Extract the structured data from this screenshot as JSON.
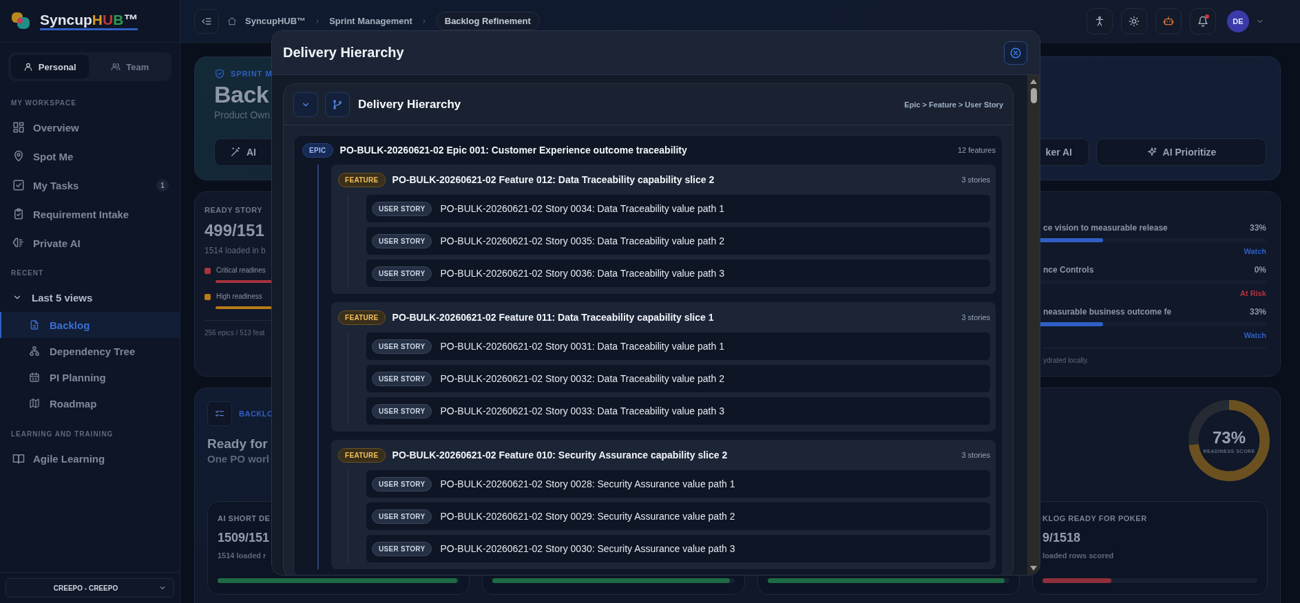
{
  "sidebar": {
    "brand": [
      {
        "text": "Syncup",
        "color": "#e2e6ee"
      },
      {
        "text": "H",
        "color": "#d99a1c"
      },
      {
        "text": "U",
        "color": "#c23a3a"
      },
      {
        "text": "B",
        "color": "#2f9a52"
      },
      {
        "text": "™",
        "color": "#e2e6ee"
      }
    ],
    "modes": [
      {
        "label": "Personal",
        "selected": true
      },
      {
        "label": "Team",
        "selected": false
      }
    ],
    "workspace": {
      "heading": "MY WORKSPACE",
      "items": [
        {
          "label": "Overview",
          "selected": false
        },
        {
          "label": "Spot Me",
          "selected": false
        },
        {
          "label": "My Tasks",
          "selected": false,
          "badge": "1"
        },
        {
          "label": "Requirement Intake",
          "selected": false
        },
        {
          "label": "Private AI",
          "selected": false
        }
      ]
    },
    "recent": {
      "heading": "RECENT",
      "group": {
        "label": "Last 5 views",
        "expanded": true,
        "children": [
          {
            "label": "Backlog",
            "selected": true
          },
          {
            "label": "Dependency Tree",
            "selected": false
          },
          {
            "label": "PI Planning",
            "selected": false
          },
          {
            "label": "Roadmap",
            "selected": false
          }
        ]
      }
    },
    "learning": {
      "heading": "LEARNING AND TRAINING",
      "items": [
        {
          "label": "Agile Learning",
          "selected": false
        }
      ]
    },
    "workspace_select": {
      "value": "CREEPO - CREEPO"
    }
  },
  "topbar": {
    "breadcrumbs": [
      {
        "label": "SyncupHUB™",
        "current": false
      },
      {
        "label": "Sprint Management",
        "current": false
      },
      {
        "label": "Backlog Refinement",
        "current": true
      }
    ],
    "notifications_unread": true,
    "avatar": "DE"
  },
  "dashboard": {
    "hero": {
      "eyebrow": "SPRINT M",
      "title": "Back",
      "subtitle": "Product Own",
      "buttons": [
        "AI",
        "ker AI",
        "AI Prioritize"
      ]
    },
    "ready_story": {
      "label": "READY STORY",
      "value": "499/151",
      "caption": "1514 loaded in b",
      "legend": [
        {
          "label": "Critical readines",
          "color": "#a8343f",
          "level": 0.5
        },
        {
          "label": "High readiness",
          "color": "#b97a17",
          "level": 0.6
        }
      ],
      "footer": "256 epics / 513 feat"
    },
    "risks": {
      "rows": [
        {
          "title": "ce vision to measurable release",
          "percent": "33%",
          "level": 0.33,
          "status": "Watch",
          "color": "#2f5fc4"
        },
        {
          "title": "nce Controls",
          "percent": "0%",
          "level": 0,
          "status": "At Risk",
          "color": "#b8323f"
        },
        {
          "title": "neasurable business outcome fe",
          "percent": "33%",
          "level": 0.33,
          "status": "Watch",
          "color": "#2f5fc4"
        }
      ],
      "footer": "ydrated locally."
    },
    "backlog": {
      "eyebrow": "BACKLO",
      "title": "Ready for",
      "subtitle": "One PO worl",
      "score": {
        "value": "73%",
        "label": "READINESS SCORE",
        "level": 0.73
      },
      "metrics": [
        {
          "label": "AI SHORT DE",
          "value": "1509/151",
          "caption": "1514 loaded r",
          "level": 0.99,
          "color": "#1d6b45"
        },
        {
          "level": 0.98,
          "color": "#1d6b45"
        },
        {
          "level": 0.98,
          "color": "#1d6b45"
        },
        {
          "label": "KLOG READY FOR POKER",
          "value": "9/1518",
          "caption": "loaded rows scored",
          "level": 0.32,
          "color": "#8f2f3a"
        }
      ]
    }
  },
  "modal": {
    "title": "Delivery Hierarchy",
    "panel": {
      "title": "Delivery Hierarchy",
      "path": "Epic > Feature > User Story",
      "expanded": true,
      "epic": {
        "badge": "EPIC",
        "title": "PO-BULK-20260621-02 Epic 001: Customer Experience outcome traceability",
        "count": "12 features",
        "children": [
          {
            "badge": "FEATURE",
            "title": "PO-BULK-20260621-02 Feature 012: Data Traceability capability slice 2",
            "count": "3 stories",
            "children": [
              {
                "badge": "USER STORY",
                "title": "PO-BULK-20260621-02 Story 0034: Data Traceability value path 1"
              },
              {
                "badge": "USER STORY",
                "title": "PO-BULK-20260621-02 Story 0035: Data Traceability value path 2"
              },
              {
                "badge": "USER STORY",
                "title": "PO-BULK-20260621-02 Story 0036: Data Traceability value path 3"
              }
            ]
          },
          {
            "badge": "FEATURE",
            "title": "PO-BULK-20260621-02 Feature 011: Data Traceability capability slice 1",
            "count": "3 stories",
            "children": [
              {
                "badge": "USER STORY",
                "title": "PO-BULK-20260621-02 Story 0031: Data Traceability value path 1"
              },
              {
                "badge": "USER STORY",
                "title": "PO-BULK-20260621-02 Story 0032: Data Traceability value path 2"
              },
              {
                "badge": "USER STORY",
                "title": "PO-BULK-20260621-02 Story 0033: Data Traceability value path 3"
              }
            ]
          },
          {
            "badge": "FEATURE",
            "title": "PO-BULK-20260621-02 Feature 010: Security Assurance capability slice 2",
            "count": "3 stories",
            "children": [
              {
                "badge": "USER STORY",
                "title": "PO-BULK-20260621-02 Story 0028: Security Assurance value path 1"
              },
              {
                "badge": "USER STORY",
                "title": "PO-BULK-20260621-02 Story 0029: Security Assurance value path 2"
              },
              {
                "badge": "USER STORY",
                "title": "PO-BULK-20260621-02 Story 0030: Security Assurance value path 3"
              }
            ]
          }
        ]
      }
    }
  }
}
